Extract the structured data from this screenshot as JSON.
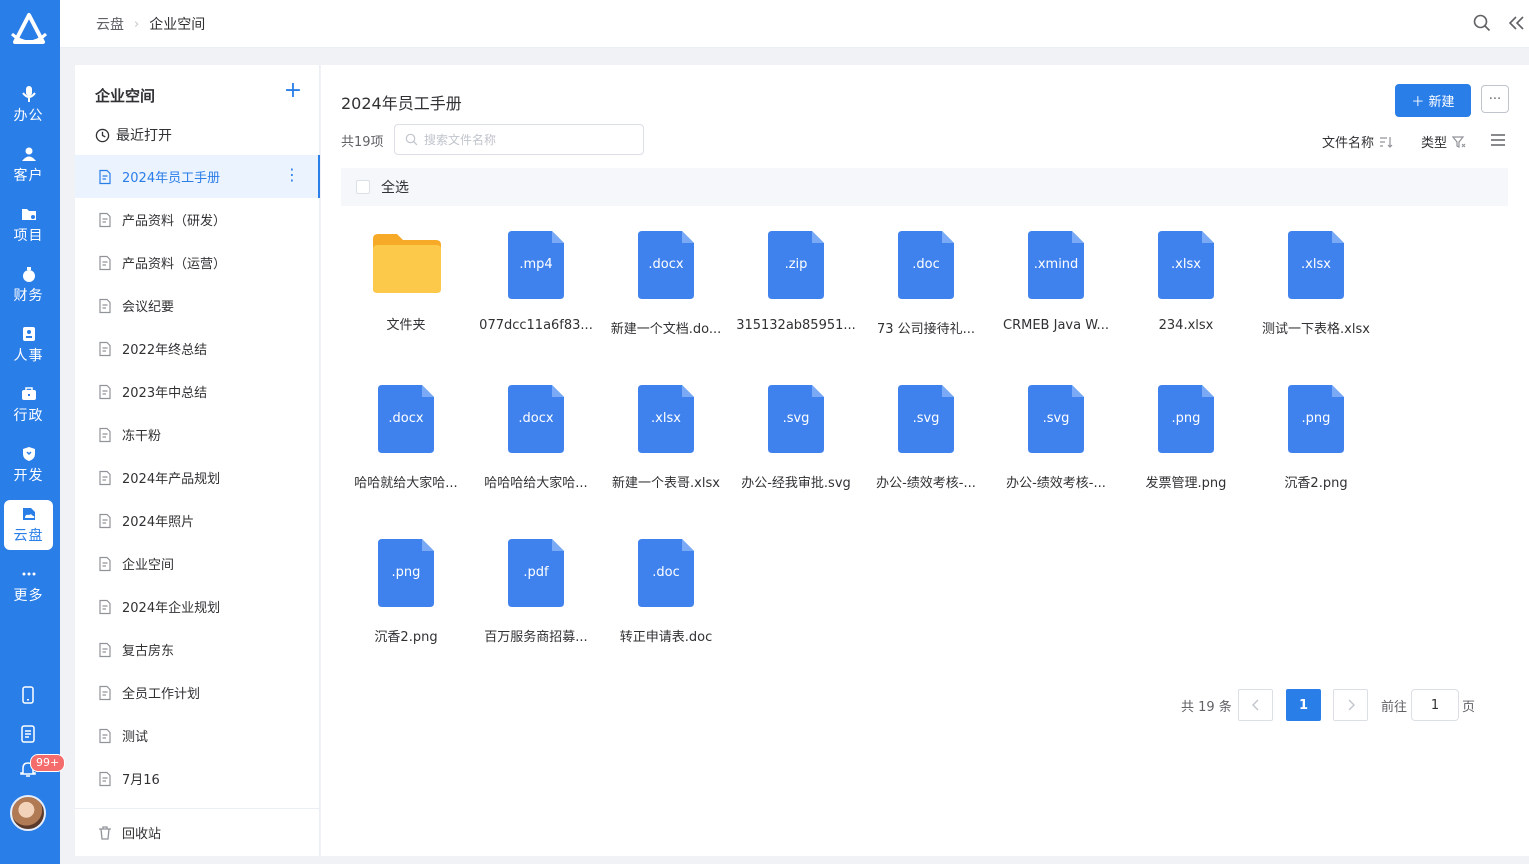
{
  "nav": {
    "items": [
      {
        "label": "办公",
        "icon": "mic-icon"
      },
      {
        "label": "客户",
        "icon": "users-icon"
      },
      {
        "label": "项目",
        "icon": "folder-icon"
      },
      {
        "label": "财务",
        "icon": "money-bag-icon"
      },
      {
        "label": "人事",
        "icon": "id-card-icon"
      },
      {
        "label": "行政",
        "icon": "briefcase-icon"
      },
      {
        "label": "开发",
        "icon": "shield-icon"
      },
      {
        "label": "云盘",
        "icon": "cloud-disk-icon"
      },
      {
        "label": "更多",
        "icon": "more-dots-icon"
      }
    ],
    "active": "云盘",
    "notification_badge": "99+"
  },
  "header": {
    "breadcrumb": [
      "云盘",
      "企业空间"
    ]
  },
  "sidebar": {
    "title": "企业空间",
    "recent": "最近打开",
    "folders": [
      "2024年员工手册",
      "产品资料（研发）",
      "产品资料（运营）",
      "会议纪要",
      "2022年终总结",
      "2023年中总结",
      "冻干粉",
      "2024年产品规划",
      "2024年照片",
      "企业空间",
      "2024年企业规划",
      "复古房东",
      "全员工作计划",
      "测试",
      "7月16"
    ],
    "active_folder": "2024年员工手册",
    "recycle": "回收站"
  },
  "main": {
    "title": "2024年员工手册",
    "count": "共19项",
    "search_placeholder": "搜索文件名称",
    "new_button": "＋ 新建",
    "more_button": "···",
    "sort_name": "文件名称",
    "sort_type": "类型",
    "select_all": "全选",
    "files": [
      {
        "ext": "",
        "name": "文件夹",
        "kind": "folder"
      },
      {
        "ext": ".mp4",
        "name": "077dcc11a6f83...",
        "kind": "file"
      },
      {
        "ext": ".docx",
        "name": "新建一个文档.do...",
        "kind": "file"
      },
      {
        "ext": ".zip",
        "name": "315132ab85951...",
        "kind": "file"
      },
      {
        "ext": ".doc",
        "name": "73 公司接待礼...",
        "kind": "file"
      },
      {
        "ext": ".xmind",
        "name": "CRMEB Java W...",
        "kind": "file"
      },
      {
        "ext": ".xlsx",
        "name": "234.xlsx",
        "kind": "file"
      },
      {
        "ext": ".xlsx",
        "name": "测试一下表格.xlsx",
        "kind": "file"
      },
      {
        "ext": ".docx",
        "name": "哈哈就给大家哈...",
        "kind": "file"
      },
      {
        "ext": ".docx",
        "name": "哈哈哈给大家哈...",
        "kind": "file"
      },
      {
        "ext": ".xlsx",
        "name": "新建一个表哥.xlsx",
        "kind": "file"
      },
      {
        "ext": ".svg",
        "name": "办公-经我审批.svg",
        "kind": "file"
      },
      {
        "ext": ".svg",
        "name": "办公-绩效考核-...",
        "kind": "file"
      },
      {
        "ext": ".svg",
        "name": "办公-绩效考核-...",
        "kind": "file"
      },
      {
        "ext": ".png",
        "name": "发票管理.png",
        "kind": "file"
      },
      {
        "ext": ".png",
        "name": "沉香2.png",
        "kind": "file"
      },
      {
        "ext": ".png",
        "name": "沉香2.png",
        "kind": "file"
      },
      {
        "ext": ".pdf",
        "name": "百万服务商招募...",
        "kind": "file"
      },
      {
        "ext": ".doc",
        "name": "转正申请表.doc",
        "kind": "file"
      }
    ],
    "pagination": {
      "total": "共 19 条",
      "current": "1",
      "goto_label": "前往",
      "goto_value": "1",
      "page_suffix": "页"
    }
  },
  "colors": {
    "accent": "#2a7ee8",
    "file_icon": "#3f82ee",
    "folder": "#f7b733"
  }
}
